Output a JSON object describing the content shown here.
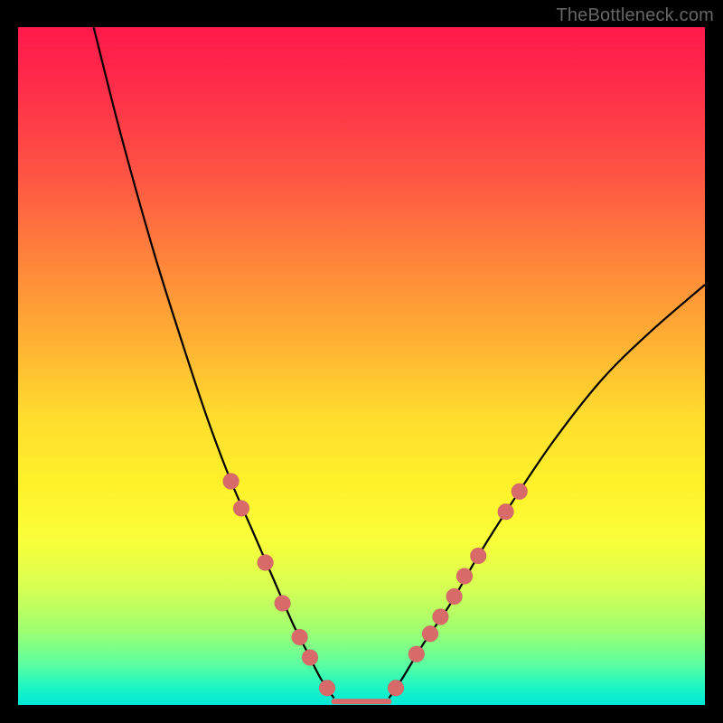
{
  "watermark": "TheBottleneck.com",
  "chart_data": {
    "type": "line",
    "title": "",
    "xlabel": "",
    "ylabel": "",
    "xlim": [
      0,
      100
    ],
    "ylim": [
      0,
      100
    ],
    "grid": false,
    "legend": false,
    "gradient_stops": [
      {
        "pos": 0,
        "color": "#ff1a4b"
      },
      {
        "pos": 8,
        "color": "#ff2a4a"
      },
      {
        "pos": 22,
        "color": "#ff5544"
      },
      {
        "pos": 36,
        "color": "#ff8a3a"
      },
      {
        "pos": 48,
        "color": "#ffb733"
      },
      {
        "pos": 58,
        "color": "#ffde2d"
      },
      {
        "pos": 68,
        "color": "#fff22a"
      },
      {
        "pos": 76,
        "color": "#f9ff3a"
      },
      {
        "pos": 83,
        "color": "#d4ff55"
      },
      {
        "pos": 89,
        "color": "#9fff70"
      },
      {
        "pos": 94,
        "color": "#5cffa0"
      },
      {
        "pos": 97,
        "color": "#22f7c0"
      },
      {
        "pos": 100,
        "color": "#00e8d8"
      }
    ],
    "series": [
      {
        "name": "left-branch",
        "x": [
          11,
          15,
          20,
          25,
          28,
          31,
          34,
          37,
          40,
          42,
          44,
          46
        ],
        "y": [
          100,
          84,
          66,
          50,
          41,
          33,
          26,
          19,
          12,
          8,
          4,
          1
        ]
      },
      {
        "name": "flat-bottom",
        "x": [
          46,
          54
        ],
        "y": [
          0.5,
          0.5
        ]
      },
      {
        "name": "right-branch",
        "x": [
          54,
          56,
          59,
          63,
          67,
          72,
          78,
          85,
          92,
          100
        ],
        "y": [
          1,
          4,
          9,
          15,
          22,
          30,
          39,
          48,
          55,
          62
        ]
      }
    ],
    "markers": {
      "name": "highlight-dots",
      "color": "#d96a6a",
      "radius": 9,
      "points": [
        {
          "x": 31,
          "y": 33
        },
        {
          "x": 32.5,
          "y": 29
        },
        {
          "x": 36,
          "y": 21
        },
        {
          "x": 38.5,
          "y": 15
        },
        {
          "x": 41,
          "y": 10
        },
        {
          "x": 42.5,
          "y": 7
        },
        {
          "x": 45,
          "y": 2.5
        },
        {
          "x": 55,
          "y": 2.5
        },
        {
          "x": 58,
          "y": 7.5
        },
        {
          "x": 60,
          "y": 10.5
        },
        {
          "x": 61.5,
          "y": 13
        },
        {
          "x": 63.5,
          "y": 16
        },
        {
          "x": 65,
          "y": 19
        },
        {
          "x": 67,
          "y": 22
        },
        {
          "x": 71,
          "y": 28.5
        },
        {
          "x": 73,
          "y": 31.5
        }
      ]
    }
  }
}
